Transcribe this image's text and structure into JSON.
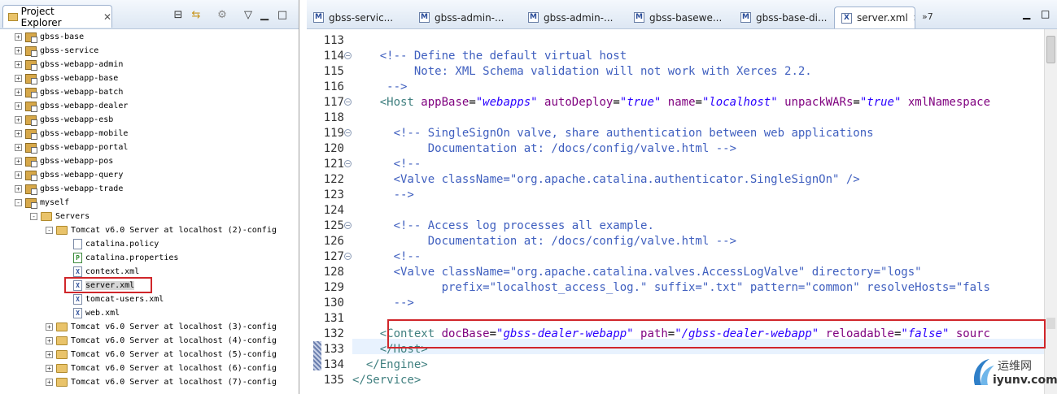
{
  "explorer": {
    "title": "Project Explorer",
    "items": [
      {
        "label": "gbss-base",
        "kind": "proj",
        "depth": 0,
        "exp": "+"
      },
      {
        "label": "gbss-service",
        "kind": "proj",
        "depth": 0,
        "exp": "+"
      },
      {
        "label": "gbss-webapp-admin",
        "kind": "proj",
        "depth": 0,
        "exp": "+"
      },
      {
        "label": "gbss-webapp-base",
        "kind": "proj",
        "depth": 0,
        "exp": "+"
      },
      {
        "label": "gbss-webapp-batch",
        "kind": "proj",
        "depth": 0,
        "exp": "+"
      },
      {
        "label": "gbss-webapp-dealer",
        "kind": "proj",
        "depth": 0,
        "exp": "+"
      },
      {
        "label": "gbss-webapp-esb",
        "kind": "proj",
        "depth": 0,
        "exp": "+"
      },
      {
        "label": "gbss-webapp-mobile",
        "kind": "proj",
        "depth": 0,
        "exp": "+"
      },
      {
        "label": "gbss-webapp-portal",
        "kind": "proj",
        "depth": 0,
        "exp": "+"
      },
      {
        "label": "gbss-webapp-pos",
        "kind": "proj",
        "depth": 0,
        "exp": "+"
      },
      {
        "label": "gbss-webapp-query",
        "kind": "proj",
        "depth": 0,
        "exp": "+"
      },
      {
        "label": "gbss-webapp-trade",
        "kind": "proj",
        "depth": 0,
        "exp": "+"
      },
      {
        "label": "myself",
        "kind": "proj",
        "depth": 0,
        "exp": "-"
      },
      {
        "label": "Servers",
        "kind": "fold",
        "depth": 1,
        "exp": "-"
      },
      {
        "label": "Tomcat v6.0 Server at localhost (2)-config",
        "kind": "fold",
        "depth": 2,
        "exp": "-"
      },
      {
        "label": "catalina.policy",
        "kind": "file",
        "depth": 3,
        "exp": ""
      },
      {
        "label": "catalina.properties",
        "kind": "pfile",
        "depth": 3,
        "exp": ""
      },
      {
        "label": "context.xml",
        "kind": "xfile",
        "depth": 3,
        "exp": ""
      },
      {
        "label": "server.xml",
        "kind": "xfile",
        "depth": 3,
        "exp": ""
      },
      {
        "label": "tomcat-users.xml",
        "kind": "xfile",
        "depth": 3,
        "exp": ""
      },
      {
        "label": "web.xml",
        "kind": "xfile",
        "depth": 3,
        "exp": ""
      },
      {
        "label": "Tomcat v6.0 Server at localhost (3)-config",
        "kind": "fold",
        "depth": 2,
        "exp": "+"
      },
      {
        "label": "Tomcat v6.0 Server at localhost (4)-config",
        "kind": "fold",
        "depth": 2,
        "exp": "+"
      },
      {
        "label": "Tomcat v6.0 Server at localhost (5)-config",
        "kind": "fold",
        "depth": 2,
        "exp": "+"
      },
      {
        "label": "Tomcat v6.0 Server at localhost (6)-config",
        "kind": "fold",
        "depth": 2,
        "exp": "+"
      },
      {
        "label": "Tomcat v6.0 Server at localhost (7)-config",
        "kind": "fold",
        "depth": 2,
        "exp": "+"
      }
    ]
  },
  "editor": {
    "tabs": [
      {
        "label": "gbss-servic...",
        "icon": "M"
      },
      {
        "label": "gbss-admin-...",
        "icon": "M"
      },
      {
        "label": "gbss-admin-...",
        "icon": "M"
      },
      {
        "label": "gbss-basewe...",
        "icon": "M"
      },
      {
        "label": "gbss-base-di...",
        "icon": "M"
      },
      {
        "label": "server.xml",
        "icon": "X",
        "active": true
      }
    ],
    "overflow": "»7",
    "fold_lines": [
      "114",
      "117",
      "119",
      "121",
      "125",
      "127"
    ],
    "lines": [
      {
        "n": "113",
        "segs": []
      },
      {
        "n": "114",
        "segs": [
          [
            "t",
            "    "
          ],
          [
            "cm",
            "<!-- Define the default virtual host"
          ]
        ]
      },
      {
        "n": "115",
        "segs": [
          [
            "cm",
            "         Note: XML Schema validation will not work with Xerces 2.2."
          ]
        ]
      },
      {
        "n": "116",
        "segs": [
          [
            "cm",
            "     -->"
          ]
        ]
      },
      {
        "n": "117",
        "segs": [
          [
            "t",
            "    "
          ],
          [
            "tg",
            "<Host "
          ],
          [
            "an",
            "appBase"
          ],
          [
            "t",
            "="
          ],
          [
            "av",
            "\"webapps\""
          ],
          [
            "t",
            " "
          ],
          [
            "an",
            "autoDeploy"
          ],
          [
            "t",
            "="
          ],
          [
            "av",
            "\"true\""
          ],
          [
            "t",
            " "
          ],
          [
            "an",
            "name"
          ],
          [
            "t",
            "="
          ],
          [
            "av",
            "\"localhost\""
          ],
          [
            "t",
            " "
          ],
          [
            "an",
            "unpackWARs"
          ],
          [
            "t",
            "="
          ],
          [
            "av",
            "\"true\""
          ],
          [
            "t",
            " "
          ],
          [
            "an",
            "xmlNamespace"
          ]
        ]
      },
      {
        "n": "118",
        "segs": []
      },
      {
        "n": "119",
        "segs": [
          [
            "t",
            "      "
          ],
          [
            "cm",
            "<!-- SingleSignOn valve, share authentication between web applications"
          ]
        ]
      },
      {
        "n": "120",
        "segs": [
          [
            "cm",
            "           Documentation at: /docs/config/valve.html -->"
          ]
        ]
      },
      {
        "n": "121",
        "segs": [
          [
            "t",
            "      "
          ],
          [
            "cm",
            "<!--"
          ]
        ]
      },
      {
        "n": "122",
        "segs": [
          [
            "cm",
            "      <Valve className=\"org.apache.catalina.authenticator.SingleSignOn\" />"
          ]
        ]
      },
      {
        "n": "123",
        "segs": [
          [
            "cm",
            "      -->"
          ]
        ]
      },
      {
        "n": "124",
        "segs": []
      },
      {
        "n": "125",
        "segs": [
          [
            "t",
            "      "
          ],
          [
            "cm",
            "<!-- Access log processes all example."
          ]
        ]
      },
      {
        "n": "126",
        "segs": [
          [
            "cm",
            "           Documentation at: /docs/config/valve.html -->"
          ]
        ]
      },
      {
        "n": "127",
        "segs": [
          [
            "t",
            "      "
          ],
          [
            "cm",
            "<!--"
          ]
        ]
      },
      {
        "n": "128",
        "segs": [
          [
            "cm",
            "      <Valve className=\"org.apache.catalina.valves.AccessLogValve\" directory=\"logs\""
          ]
        ]
      },
      {
        "n": "129",
        "segs": [
          [
            "cm",
            "             prefix=\"localhost_access_log.\" suffix=\".txt\" pattern=\"common\" resolveHosts=\"fals"
          ]
        ]
      },
      {
        "n": "130",
        "segs": [
          [
            "cm",
            "      -->"
          ]
        ]
      },
      {
        "n": "131",
        "segs": []
      },
      {
        "n": "132",
        "segs": [
          [
            "t",
            "    "
          ],
          [
            "tg",
            "<Context "
          ],
          [
            "an",
            "docBase"
          ],
          [
            "t",
            "="
          ],
          [
            "av",
            "\"gbss-dealer-webapp\""
          ],
          [
            "t",
            " "
          ],
          [
            "an",
            "path"
          ],
          [
            "t",
            "="
          ],
          [
            "av",
            "\"/gbss-dealer-webapp\""
          ],
          [
            "t",
            " "
          ],
          [
            "an",
            "reloadable"
          ],
          [
            "t",
            "="
          ],
          [
            "av",
            "\"false\""
          ],
          [
            "t",
            " "
          ],
          [
            "an",
            "sourc"
          ]
        ]
      },
      {
        "n": "133",
        "segs": [
          [
            "t",
            "    "
          ],
          [
            "tg",
            "</Host>"
          ]
        ]
      },
      {
        "n": "134",
        "segs": [
          [
            "t",
            "  "
          ],
          [
            "tg",
            "</Engine>"
          ]
        ]
      },
      {
        "n": "135",
        "segs": [
          [
            "tg",
            "</Service>"
          ]
        ]
      }
    ]
  },
  "watermark": {
    "name": "运维网",
    "site": "iyunv.com"
  }
}
